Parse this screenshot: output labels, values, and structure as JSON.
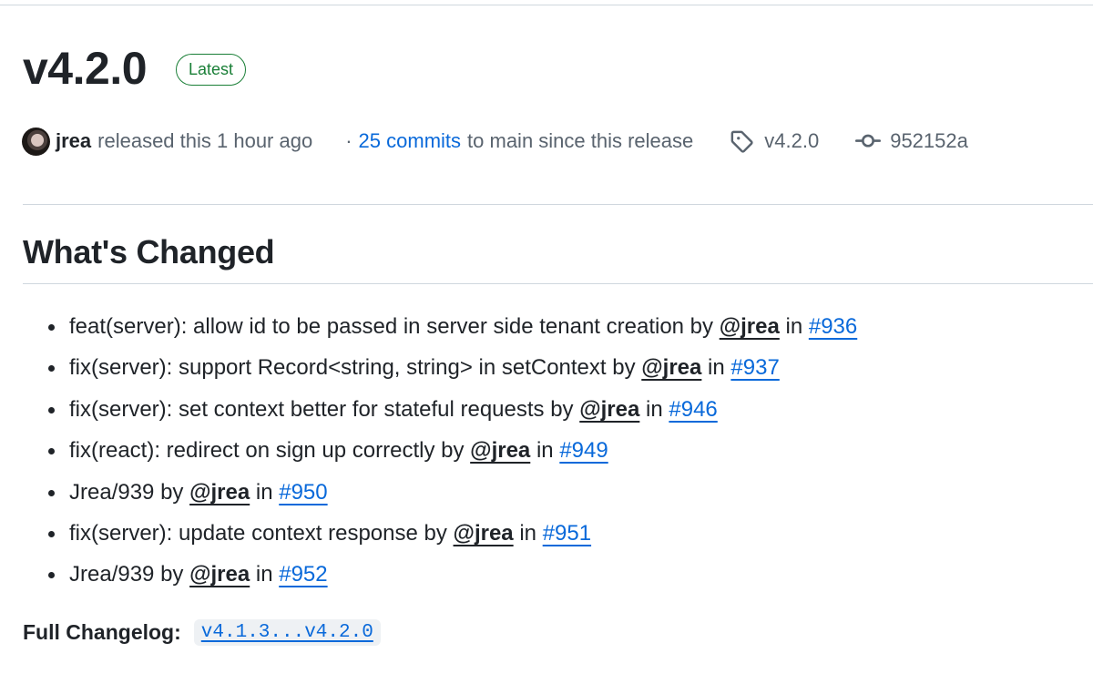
{
  "release": {
    "version": "v4.2.0",
    "badge": "Latest"
  },
  "meta": {
    "author": "jrea",
    "released_text": "released this 1 hour ago",
    "separator": "·",
    "commits_link": "25 commits",
    "commits_suffix": "to main since this release",
    "tag": "v4.2.0",
    "commit": "952152a"
  },
  "section": {
    "heading": "What's Changed"
  },
  "changes": [
    {
      "text": "feat(server): allow id to be passed in server side tenant creation by",
      "author": "@jrea",
      "in": "in",
      "pr": "#936"
    },
    {
      "text": "fix(server): support Record<string, string> in setContext by",
      "author": "@jrea",
      "in": "in",
      "pr": "#937"
    },
    {
      "text": "fix(server): set context better for stateful requests by",
      "author": "@jrea",
      "in": "in",
      "pr": "#946"
    },
    {
      "text": "fix(react): redirect on sign up correctly by",
      "author": "@jrea",
      "in": "in",
      "pr": "#949"
    },
    {
      "text": "Jrea/939 by",
      "author": "@jrea",
      "in": "in",
      "pr": "#950"
    },
    {
      "text": "fix(server): update context response by",
      "author": "@jrea",
      "in": "in",
      "pr": "#951"
    },
    {
      "text": "Jrea/939 by",
      "author": "@jrea",
      "in": "in",
      "pr": "#952"
    }
  ],
  "changelog": {
    "label": "Full Changelog",
    "range": "v4.1.3...v4.2.0"
  },
  "colors": {
    "link": "#0969da",
    "badge_green": "#1a7f37",
    "text": "#1f2328",
    "muted": "#59636e"
  },
  "icons": {
    "tag": "tag-icon",
    "commit": "git-commit-icon"
  }
}
